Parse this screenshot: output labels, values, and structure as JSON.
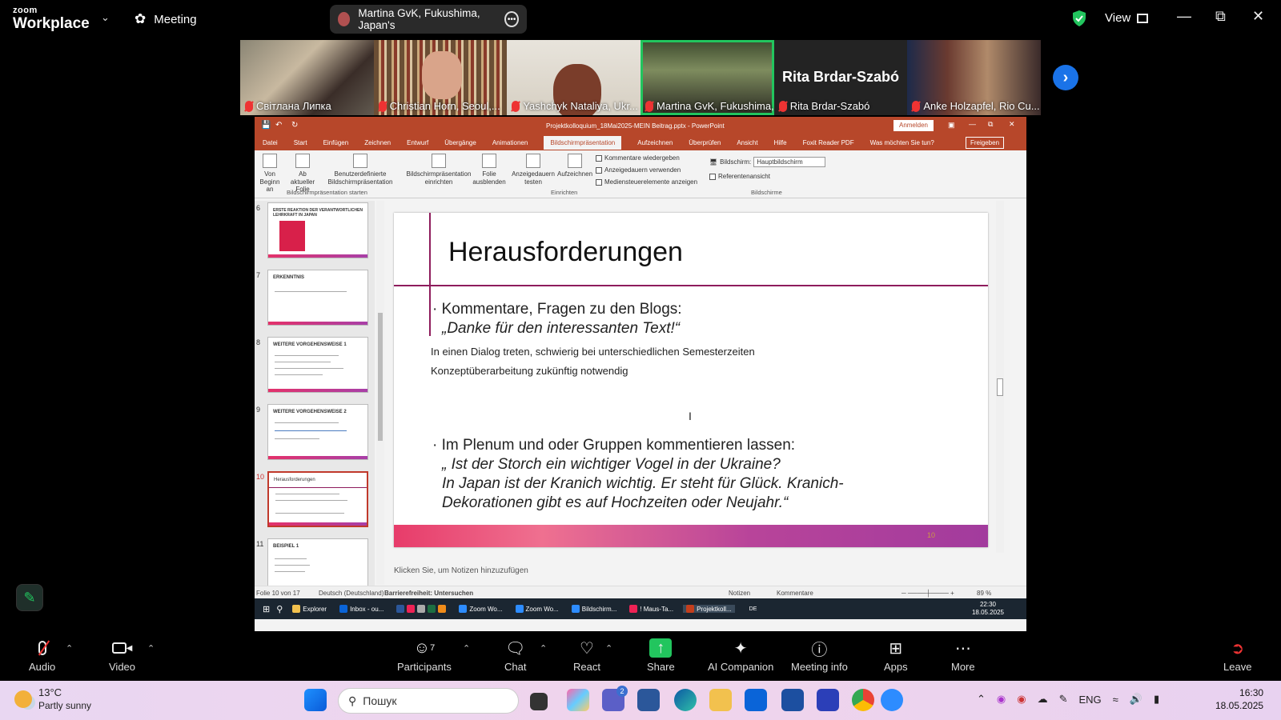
{
  "app": {
    "logo_top": "zoom",
    "logo_bottom": "Workplace",
    "meeting_label": "Meeting",
    "speaker_pill": "Martina GvK, Fukushima, Japan's",
    "view_label": "View"
  },
  "participants": [
    {
      "name": "Світлана Липка",
      "muted": true
    },
    {
      "name": "Christian Horn, Seoul,...",
      "muted": true
    },
    {
      "name": "Yashchyk Nataliya, Ukr...",
      "muted": true
    },
    {
      "name": "Martina GvK, Fukushima, J...",
      "muted": true,
      "active": true
    },
    {
      "name": "Rita Brdar-Szabó",
      "muted": true,
      "display_text": "Rita Brdar-Szabó"
    },
    {
      "name": "Anke Holzapfel, Rio Cu...",
      "muted": true
    }
  ],
  "ppt": {
    "file_title": "Projektkolloquium_18Mai2025-MEIN Beitrag.pptx  -  PowerPoint",
    "signin": "Anmelden",
    "share": "Freigeben",
    "tabs": [
      "Datei",
      "Start",
      "Einfügen",
      "Zeichnen",
      "Entwurf",
      "Übergänge",
      "Animationen",
      "Bildschirmpräsentation",
      "Aufzeichnen",
      "Überprüfen",
      "Ansicht",
      "Hilfe",
      "Foxit Reader PDF",
      "Was möchten Sie tun?"
    ],
    "active_tab": "Bildschirmpräsentation",
    "ribbon": {
      "von_beginn": "Von Beginn an",
      "ab_aktueller": "Ab aktueller Folie",
      "benutzer": "Benutzerdefinierte Bildschirmpräsentation",
      "group1": "Bildschirmpräsentation starten",
      "einrichten_btn": "Bildschirmpräsentation einrichten",
      "folie_ausblenden": "Folie ausblenden",
      "anzeigedauern": "Anzeigedauern testen",
      "aufzeichnen": "Aufzeichnen",
      "cb1": "Kommentare wiedergeben",
      "cb2": "Anzeigedauern verwenden",
      "cb3": "Mediensteuerelemente anzeigen",
      "group2": "Einrichten",
      "bildschirm_label": "Bildschirm:",
      "bildschirm_value": "Hauptbildschirm",
      "referenz": "Referentenansicht",
      "group3": "Bildschirme"
    },
    "slides": [
      {
        "num": "6",
        "title": "ERSTE REAKTION DER VERANTWORTLICHEN LEHRKRAFT IN JAPAN"
      },
      {
        "num": "7",
        "title": "ERKENNTNIS"
      },
      {
        "num": "8",
        "title": "WEITERE VORGEHENSWEISE 1"
      },
      {
        "num": "9",
        "title": "WEITERE VORGEHENSWEISE 2"
      },
      {
        "num": "10",
        "title": "Herausforderungen"
      },
      {
        "num": "11",
        "title": "BEISPIEL 1"
      }
    ],
    "current_slide": {
      "title": "Herausforderungen",
      "b1": "Kommentare, Fragen zu den Blogs:",
      "b1_quote": "„Danke für den interessanten Text!“",
      "p1": "In einen Dialog treten, schwierig bei unterschiedlichen Semesterzeiten",
      "p2": "Konzeptüberarbeitung zukünftig notwendig",
      "b2": "Im Plenum und oder Gruppen kommentieren lassen:",
      "q1": "„ Ist der Storch ein wichtiger Vogel in der Ukraine?",
      "q2": "In Japan ist der Kranich wichtig. Er steht für Glück. Kranich-",
      "q3": "Dekorationen gibt es auf Hochzeiten oder Neujahr.“",
      "page_num": "10"
    },
    "notes_placeholder": "Klicken Sie, um Notizen hinzuzufügen",
    "status": {
      "slide": "Folie 10 von 17",
      "lang": "Deutsch (Deutschland)",
      "access": "Barrierefreiheit: Untersuchen",
      "notes": "Notizen",
      "comments": "Kommentare",
      "zoom": "89 %"
    },
    "inner_taskbar": [
      "Explorer",
      "Inbox - ou...",
      "Zoom Wo...",
      "Zoom Wo...",
      "Bildschirm...",
      "! Maus-Ta...",
      "Projektkoll..."
    ],
    "inner_clock": {
      "time": "22:30",
      "date": "18.05.2025",
      "lang": "DE"
    }
  },
  "toolbar": {
    "audio": "Audio",
    "video": "Video",
    "participants": "Participants",
    "participants_count": "7",
    "chat": "Chat",
    "react": "React",
    "share": "Share",
    "ai": "AI Companion",
    "info": "Meeting info",
    "apps": "Apps",
    "more": "More",
    "leave": "Leave"
  },
  "taskbar": {
    "temp": "13°C",
    "weather": "Partly sunny",
    "search_placeholder": "Пошук",
    "teams_badge": "2",
    "lang": "ENG",
    "time": "16:30",
    "date": "18.05.2025"
  },
  "colors": {
    "accent_green": "#22c55e",
    "ppt_red": "#b7472a",
    "zoom_blue": "#1a73e8"
  }
}
